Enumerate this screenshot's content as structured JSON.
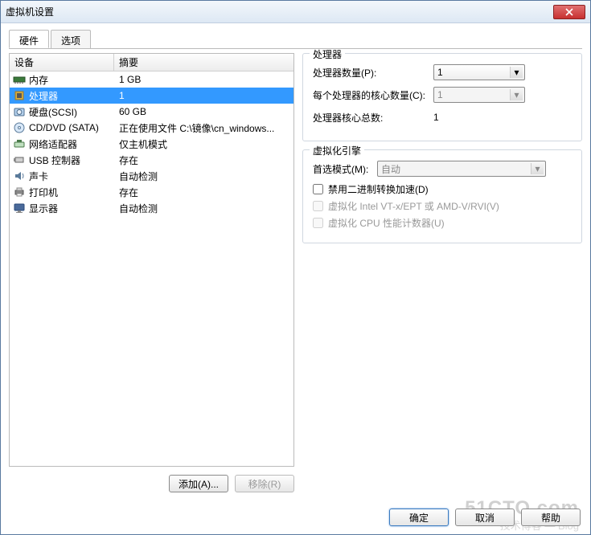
{
  "title": "虚拟机设置",
  "tabs": {
    "hardware": "硬件",
    "options": "选项"
  },
  "list": {
    "header_device": "设备",
    "header_summary": "摘要",
    "items": [
      {
        "name": "内存",
        "summary": "1 GB",
        "icon": "memory"
      },
      {
        "name": "处理器",
        "summary": "1",
        "icon": "cpu",
        "selected": true
      },
      {
        "name": "硬盘(SCSI)",
        "summary": "60 GB",
        "icon": "disk"
      },
      {
        "name": "CD/DVD (SATA)",
        "summary": "正在使用文件 C:\\镜像\\cn_windows...",
        "icon": "cd"
      },
      {
        "name": "网络适配器",
        "summary": "仅主机模式",
        "icon": "net"
      },
      {
        "name": "USB 控制器",
        "summary": "存在",
        "icon": "usb"
      },
      {
        "name": "声卡",
        "summary": "自动检测",
        "icon": "sound"
      },
      {
        "name": "打印机",
        "summary": "存在",
        "icon": "printer"
      },
      {
        "name": "显示器",
        "summary": "自动检测",
        "icon": "display"
      }
    ]
  },
  "left_buttons": {
    "add": "添加(A)...",
    "remove": "移除(R)"
  },
  "proc_group": {
    "title": "处理器",
    "count_label": "处理器数量(P):",
    "count_value": "1",
    "cores_label": "每个处理器的核心数量(C):",
    "cores_value": "1",
    "total_label": "处理器核心总数:",
    "total_value": "1"
  },
  "engine_group": {
    "title": "虚拟化引擎",
    "mode_label": "首选模式(M):",
    "mode_value": "自动",
    "cb_disable_binary": "禁用二进制转换加速(D)",
    "cb_vt": "虚拟化 Intel VT-x/EPT 或 AMD-V/RVI(V)",
    "cb_counters": "虚拟化 CPU 性能计数器(U)"
  },
  "bottom": {
    "ok": "确定",
    "cancel": "取消",
    "help": "帮助"
  },
  "watermark": "51CTO.com",
  "watermark_sub": "技术博客 — Blog"
}
